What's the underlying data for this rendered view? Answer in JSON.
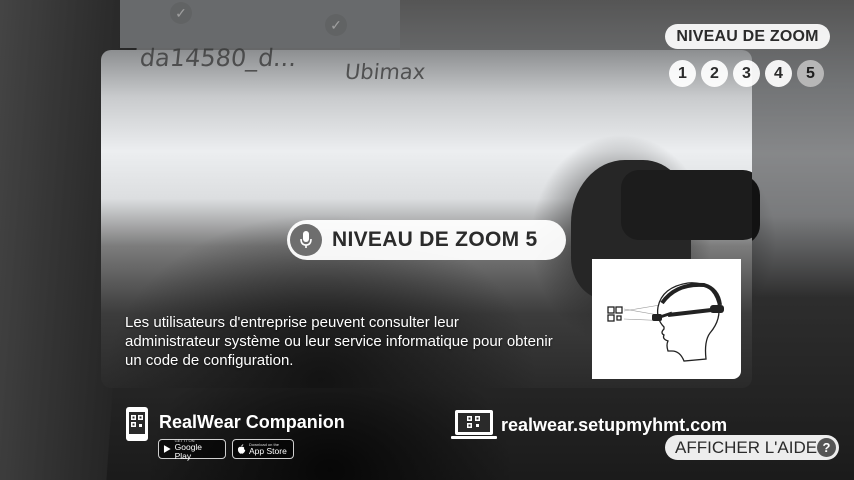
{
  "zoom": {
    "label": "NIVEAU DE ZOOM",
    "levels": [
      "1",
      "2",
      "3",
      "4",
      "5"
    ],
    "active_level": "5"
  },
  "voice_command": {
    "text": "NIVEAU DE ZOOM 5",
    "icon": "microphone-icon"
  },
  "info": {
    "text": "Les utilisateurs d'entreprise peuvent consulter leur administrateur système ou leur service informatique pour obtenir un code de configuration."
  },
  "companion": {
    "title": "RealWear Companion",
    "icon": "phone-qr-icon",
    "stores": [
      {
        "small": "GET IT ON",
        "big": "Google Play",
        "icon": "play-store-icon"
      },
      {
        "small": "Download on the",
        "big": "App Store",
        "icon": "apple-icon"
      }
    ]
  },
  "website": {
    "url": "realwear.setupmyhmt.com",
    "icon": "laptop-qr-icon"
  },
  "help": {
    "label": "AFFICHER L'AIDE",
    "icon_glyph": "?"
  },
  "background": {
    "text_1": "da14580_d...",
    "text_2": "Ubimax"
  },
  "colors": {
    "pill_bg": "#ffffff",
    "pill_text": "#2b2b2b",
    "active_level_bg": "#b7b7b7",
    "mic_circle": "#6e6e6e"
  }
}
